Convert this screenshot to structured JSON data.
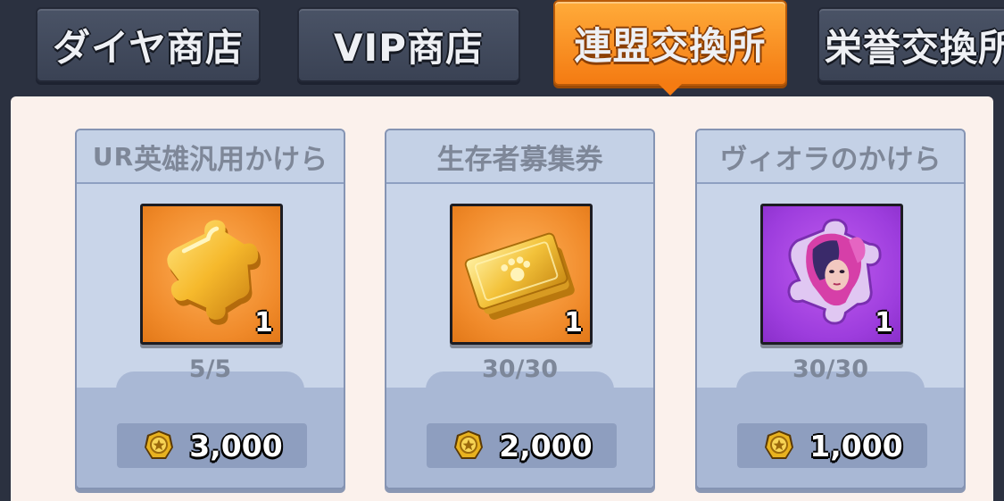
{
  "tabs": [
    {
      "label": "ダイヤ商店",
      "active": false
    },
    {
      "label": "VIP商店",
      "active": false
    },
    {
      "label": "連盟交換所",
      "active": true
    },
    {
      "label": "栄誉交換所",
      "active": false
    }
  ],
  "items": [
    {
      "title_prefix": "UR",
      "title": "英雄汎用かけら",
      "icon": "puzzle-piece-icon",
      "quantity": "1",
      "stock": "5/5",
      "price": "3,000"
    },
    {
      "title_prefix": "",
      "title": "生存者募集券",
      "icon": "recruit-ticket-icon",
      "quantity": "1",
      "stock": "30/30",
      "price": "2,000"
    },
    {
      "title_prefix": "",
      "title": "ヴィオラのかけら",
      "icon": "viola-shard-icon",
      "quantity": "1",
      "stock": "30/30",
      "price": "1,000"
    }
  ],
  "currency_icon": "alliance-medal-icon",
  "colors": {
    "active_tab": "#f47b12",
    "inactive_tab": "#3a4254",
    "orange_icon_bg": "#f08a2a",
    "purple_icon_bg": "#9d3ddd",
    "medal_gold": "#e8b21f"
  }
}
